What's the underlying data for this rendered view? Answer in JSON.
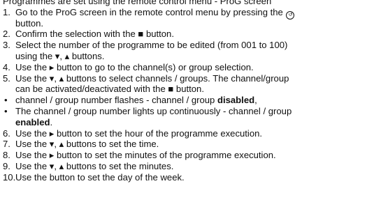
{
  "document": {
    "intro": "Programmes are set using the remote control menu - ProG screen",
    "steps": [
      {
        "num": "1.",
        "lines": [
          "Go to the ProG screen in the remote control menu by pressing the",
          "button."
        ]
      },
      {
        "num": "2.",
        "lines": [
          "Confirm the selection with the ■ button."
        ]
      },
      {
        "num": "3.",
        "lines": [
          "Select the number of the programme to be edited (from 001 to 100)",
          "using the ▾, ▴ buttons."
        ]
      },
      {
        "num": "4.",
        "lines": [
          "Use the ▸ button to go to the channel(s) or group selection."
        ]
      },
      {
        "num": "5.",
        "lines": [
          "Use the ▾, ▴ buttons to select channels / groups. The channel/group",
          "can be activated/deactivated with the ■ button."
        ]
      },
      {
        "num": "6.",
        "lines": [
          "Use the ▸ button to set the hour of the programme execution."
        ]
      },
      {
        "num": "7.",
        "lines": [
          "Use the ▾, ▴ buttons to set the time."
        ]
      },
      {
        "num": "8.",
        "lines": [
          "Use the ▸ button to set the minutes of the programme execution."
        ]
      },
      {
        "num": "9.",
        "lines": [
          "Use the ▾, ▴ buttons to set the minutes."
        ]
      },
      {
        "num": "10.",
        "lines": [
          "Use the button to set the day of the week."
        ]
      }
    ],
    "bullets": [
      {
        "text": "channel / group number flashes - channel / group ",
        "bold": "disabled",
        "tail": ","
      },
      {
        "text": "The channel / group number lights up continuously - channel / group",
        "bold": "enabled",
        "tail": "."
      }
    ],
    "bullet_symbol": "•",
    "remote_icon_glyph": "↺"
  }
}
